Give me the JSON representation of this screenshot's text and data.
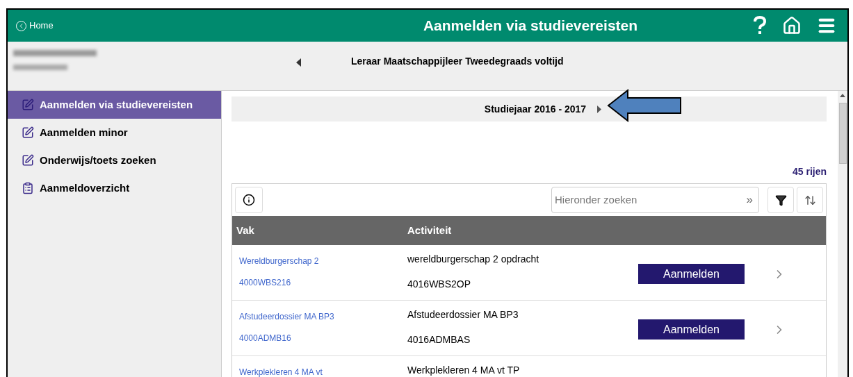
{
  "header": {
    "back_link": "Home",
    "title": "Aanmelden via studievereisten"
  },
  "program": {
    "title": "Leraar Maatschappijleer Tweedegraads voltijd"
  },
  "sidebar": {
    "items": [
      {
        "kind": "edit",
        "label": "Aanmelden via studievereisten",
        "selected": true
      },
      {
        "kind": "edit",
        "label": "Aanmelden minor",
        "selected": false
      },
      {
        "kind": "edit",
        "label": "Onderwijs/toets zoeken",
        "selected": false
      },
      {
        "kind": "list",
        "label": "Aanmeldoverzicht",
        "selected": false
      }
    ]
  },
  "year_selector": {
    "label": "Studiejaar 2016 - 2017"
  },
  "row_count": "45 rijen",
  "search": {
    "placeholder": "Hieronder zoeken",
    "submit": "»"
  },
  "table": {
    "columns": [
      "Vak",
      "Activiteit"
    ],
    "rows": [
      {
        "course": "Wereldburgerschap 2",
        "course_code": "4000WBS216",
        "activity": "wereldburgerschap 2 opdracht",
        "activity_code": "4016WBS2OP",
        "button": "Aanmelden"
      },
      {
        "course": "Afstudeerdossier MA BP3",
        "course_code": "4000ADMB16",
        "activity": "Afstudeerdossier MA BP3",
        "activity_code": "4016ADMBAS",
        "button": "Aanmelden"
      },
      {
        "course": "Werkplekleren 4 MA vt",
        "activity": "Werkplekleren 4 MA vt TP"
      }
    ]
  }
}
